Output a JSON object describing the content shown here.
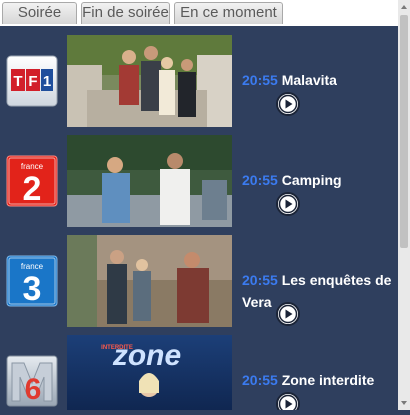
{
  "tabs": [
    "Soirée",
    "Fin de soirée",
    "En ce moment"
  ],
  "active_tab": 0,
  "programs": [
    {
      "channel": "TF1",
      "time": "20:55",
      "title": "Malavita"
    },
    {
      "channel": "France 2",
      "channel_mark": "2",
      "channel_caption": "france",
      "time": "20:55",
      "title": "Camping"
    },
    {
      "channel": "France 3",
      "channel_mark": "3",
      "channel_caption": "france",
      "time": "20:55",
      "title": "Les enquêtes de Vera"
    },
    {
      "channel": "M6",
      "channel_mark": "6",
      "time": "20:55",
      "title": "Zone interdite",
      "thumbnail_text": "zone",
      "thumbnail_subtext": "INTERDITE"
    }
  ],
  "colors": {
    "background": "#2f3f5e",
    "time": "#3b7bf0",
    "title": "#ffffff",
    "tf1_red": "#d21f2a",
    "tf1_blue": "#1f4e9c",
    "france2_red": "#e2231a",
    "france3_blue": "#1a76c8",
    "m6_gray": "#b9c3cf"
  },
  "icons": {
    "play": "play-circle-icon"
  }
}
